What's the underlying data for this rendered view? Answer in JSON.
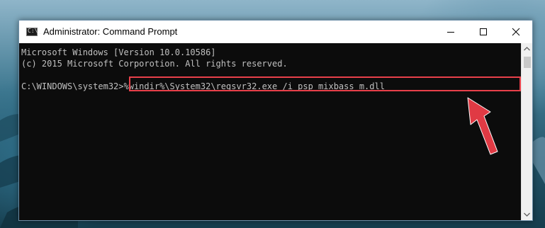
{
  "window": {
    "title": "Administrator: Command Prompt",
    "icon": "cmd-app-icon",
    "controls": {
      "minimize_icon": "minimize-icon",
      "maximize_icon": "maximize-icon",
      "close_icon": "close-icon"
    }
  },
  "console": {
    "lines": [
      "Microsoft Windows [Version 10.0.10586]",
      "(c) 2015 Microsoft Corporotion. All rights reserved.",
      ""
    ],
    "prompt": "C:\\WINDOWS\\system32>",
    "command": "%windir%\\System32\\regsvr32.exe /i psp_mixbass_m.dll"
  },
  "annotation": {
    "highlight_color": "#e8404a",
    "arrow_icon": "red-pointer-arrow-icon"
  },
  "colors": {
    "console_bg": "#0c0c0c",
    "console_text": "#c0c0c0",
    "titlebar_bg": "#ffffff"
  }
}
